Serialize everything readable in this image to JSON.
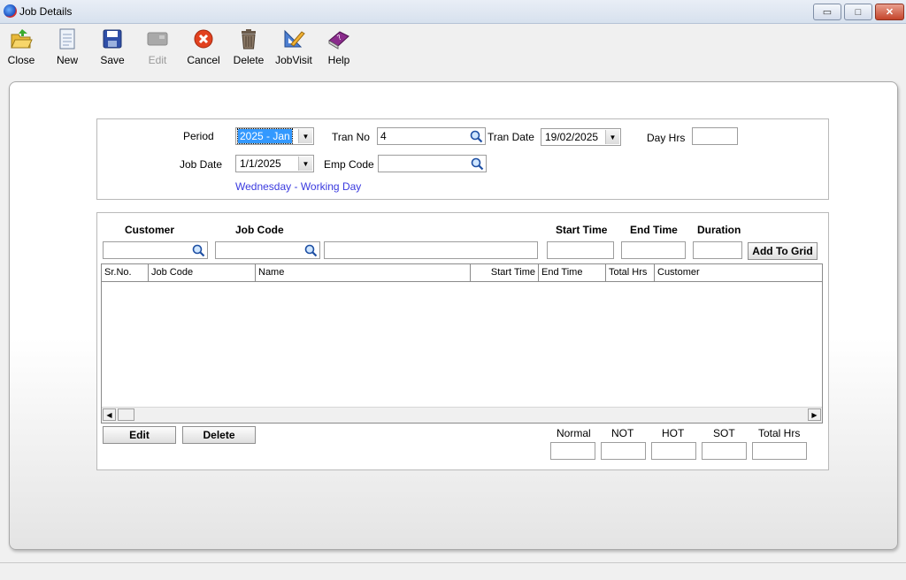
{
  "window": {
    "title": "Job Details",
    "minimize": "▭",
    "maximize": "□",
    "close": "✕"
  },
  "toolbar": {
    "close": "Close",
    "new": "New",
    "save": "Save",
    "edit": "Edit",
    "cancel": "Cancel",
    "delete": "Delete",
    "jobvisit": "JobVisit",
    "help": "Help"
  },
  "header": {
    "period_label": "Period",
    "period_value": "2025 - Jan",
    "tranno_label": "Tran No",
    "tranno_value": "4",
    "trandate_label": "Tran Date",
    "trandate_value": "19/02/2025",
    "dayhrs_label": "Day Hrs",
    "dayhrs_value": "",
    "jobdate_label": "Job Date",
    "jobdate_value": "1/1/2025",
    "empcode_label": "Emp Code",
    "empcode_value": "",
    "day_status": "Wednesday - Working Day"
  },
  "entry": {
    "customer_label": "Customer",
    "jobcode_label": "Job Code",
    "starttime_label": "Start Time",
    "endtime_label": "End Time",
    "duration_label": "Duration",
    "customer_value": "",
    "jobcode_value": "",
    "name_value": "",
    "starttime_value": "",
    "endtime_value": "",
    "duration_value": "",
    "add_button": "Add To Grid"
  },
  "grid": {
    "columns": [
      "Sr.No.",
      "Job Code",
      "Name",
      "Start Time",
      "End Time",
      "Total Hrs",
      "Customer"
    ],
    "rows": []
  },
  "footer": {
    "edit_button": "Edit",
    "delete_button": "Delete",
    "normal_label": "Normal",
    "not_label": "NOT",
    "hot_label": "HOT",
    "sot_label": "SOT",
    "total_label": "Total Hrs",
    "normal_value": "",
    "not_value": "",
    "hot_value": "",
    "sot_value": "",
    "total_value": ""
  },
  "colors": {
    "day_status": "#3a3adf",
    "selection": "#3399ff"
  }
}
